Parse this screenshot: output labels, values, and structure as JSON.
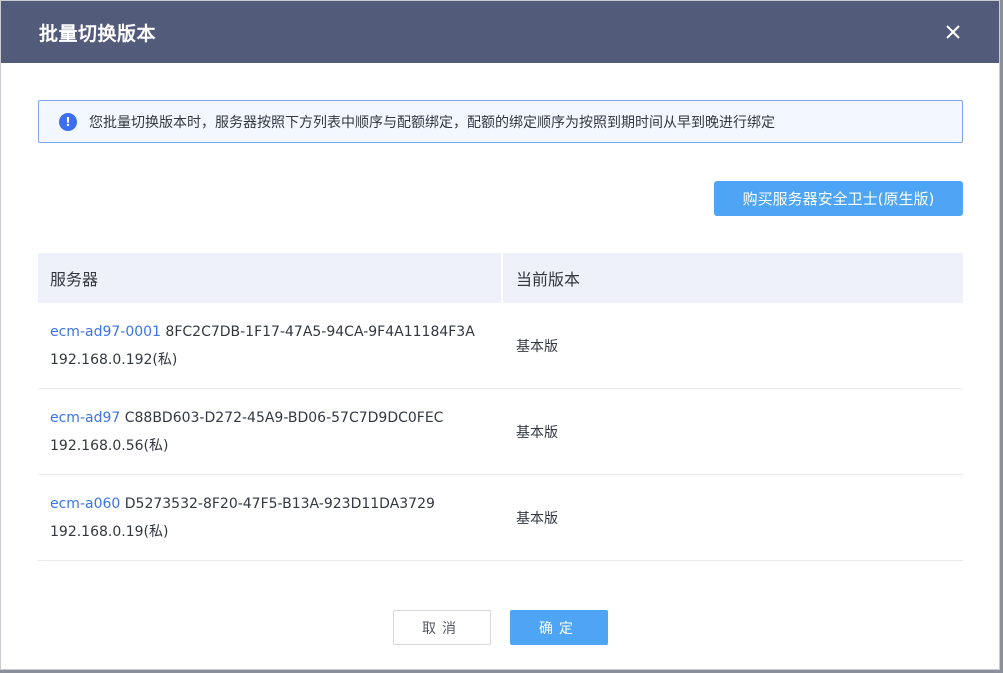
{
  "dialog": {
    "title": "批量切换版本",
    "close_icon": "close-icon"
  },
  "notice": {
    "icon": "info-icon",
    "icon_glyph": "!",
    "text": "您批量切换版本时，服务器按照下方列表中顺序与配额绑定，配额的绑定顺序为按照到期时间从早到晚进行绑定"
  },
  "buy_button": {
    "label": "购买服务器安全卫士(原生版)"
  },
  "table": {
    "headers": {
      "server": "服务器",
      "version": "当前版本"
    },
    "rows": [
      {
        "name": "ecm-ad97-0001",
        "id": "8FC2C7DB-1F17-47A5-94CA-9F4A11184F3A",
        "ip": "192.168.0.192(私)",
        "version": "基本版"
      },
      {
        "name": "ecm-ad97",
        "id": "C88BD603-D272-45A9-BD06-57C7D9DC0FEC",
        "ip": "192.168.0.56(私)",
        "version": "基本版"
      },
      {
        "name": "ecm-a060",
        "id": "D5273532-8F20-47F5-B13A-923D11DA3729",
        "ip": "192.168.0.19(私)",
        "version": "基本版"
      }
    ]
  },
  "footer": {
    "cancel_label": "取消",
    "ok_label": "确定"
  },
  "colors": {
    "header_bg": "#525c7a",
    "primary": "#4ea5f5",
    "link": "#3b74e8",
    "info": "#3b6ff0"
  }
}
